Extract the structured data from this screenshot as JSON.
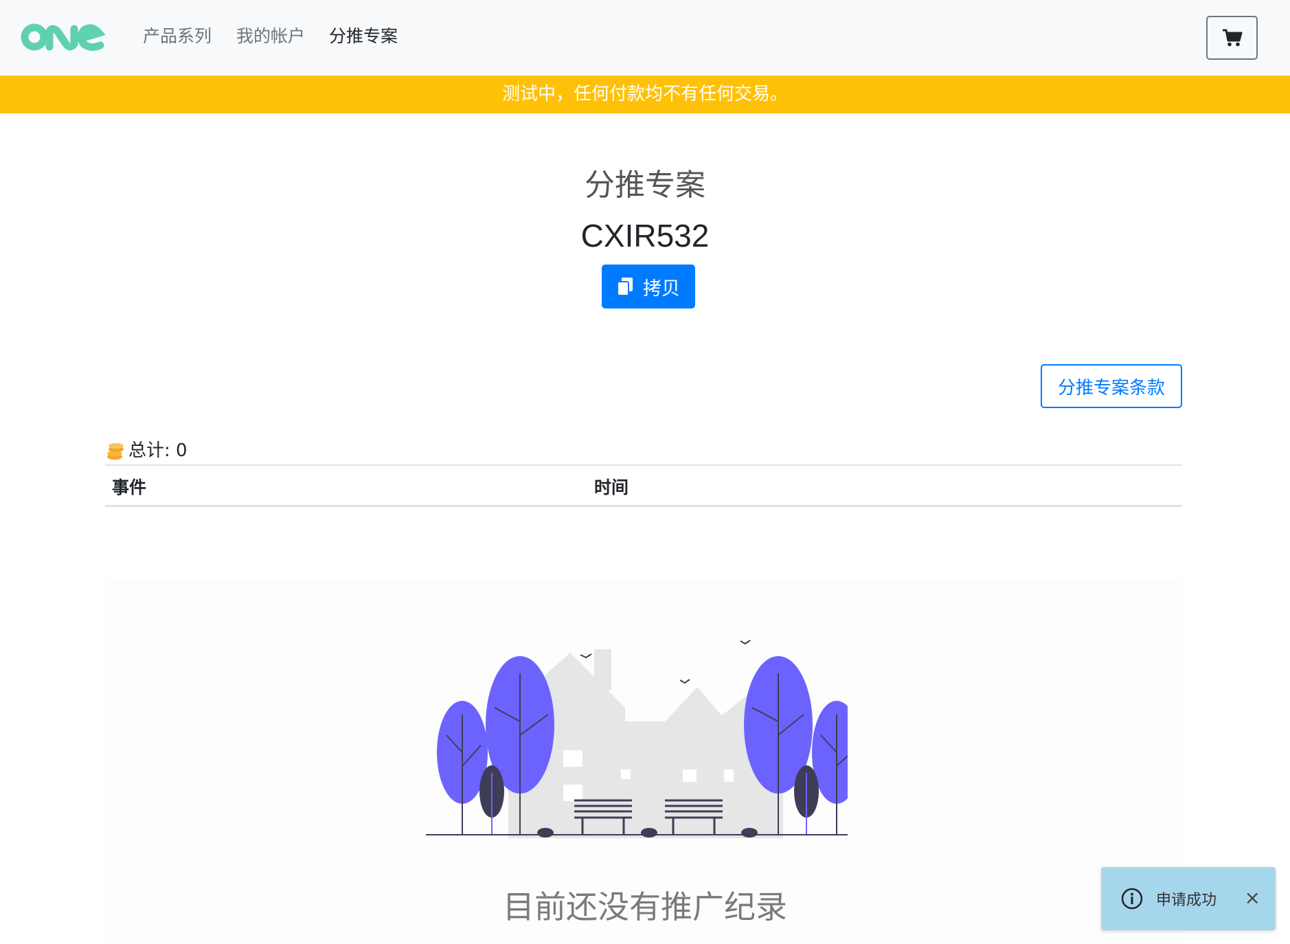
{
  "header": {
    "logo_text": "ONE",
    "nav": [
      {
        "label": "产品系列"
      },
      {
        "label": "我的帐户"
      },
      {
        "label": "分推专案"
      }
    ],
    "cart_icon": "cart-icon"
  },
  "banner": {
    "text": "测试中，任何付款均不有任何交易。",
    "color": "#ffc107"
  },
  "main": {
    "title": "分推专案",
    "ref_code": "CXIR532",
    "copy_label": "拷贝",
    "copy_icon": "copy-icon",
    "terms_label": "分推专案条款",
    "total_label": "总计: 0",
    "total_icon": "coins-icon",
    "table": {
      "headers": [
        "事件",
        "时间"
      ],
      "rows": []
    },
    "empty_text": "目前还没有推广纪录"
  },
  "toast": {
    "message": "申请成功",
    "icon": "info-icon",
    "close": "×"
  },
  "colors": {
    "primary": "#007bff",
    "warning": "#ffc107",
    "logo": "#5fd1b0",
    "tree": "#6c63ff"
  }
}
